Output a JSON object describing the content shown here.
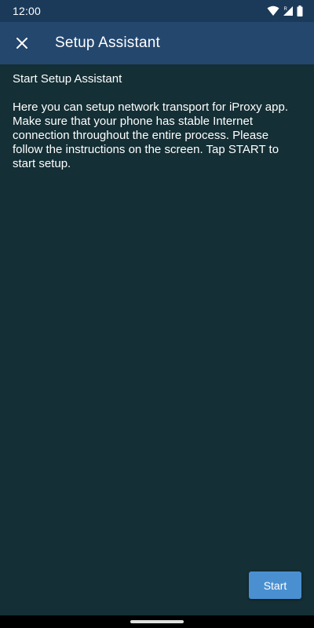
{
  "status_bar": {
    "time": "12:00",
    "icons": [
      "wifi-icon",
      "signal-icon",
      "battery-icon"
    ],
    "roaming_indicator": "R"
  },
  "app_bar": {
    "close_icon": "close-icon",
    "title": "Setup Assistant"
  },
  "content": {
    "heading": "Start Setup Assistant",
    "body": "Here you can setup network transport for iProxy app. Make sure that your phone has stable Internet connection throughout the entire process. Please follow the instructions on the screen. Tap START to start setup."
  },
  "actions": {
    "start_label": "Start"
  },
  "colors": {
    "status_bar": "#1b3a5a",
    "app_bar": "#24476e",
    "background": "#142f35",
    "button": "#4a90d0",
    "text": "#ffffff"
  }
}
